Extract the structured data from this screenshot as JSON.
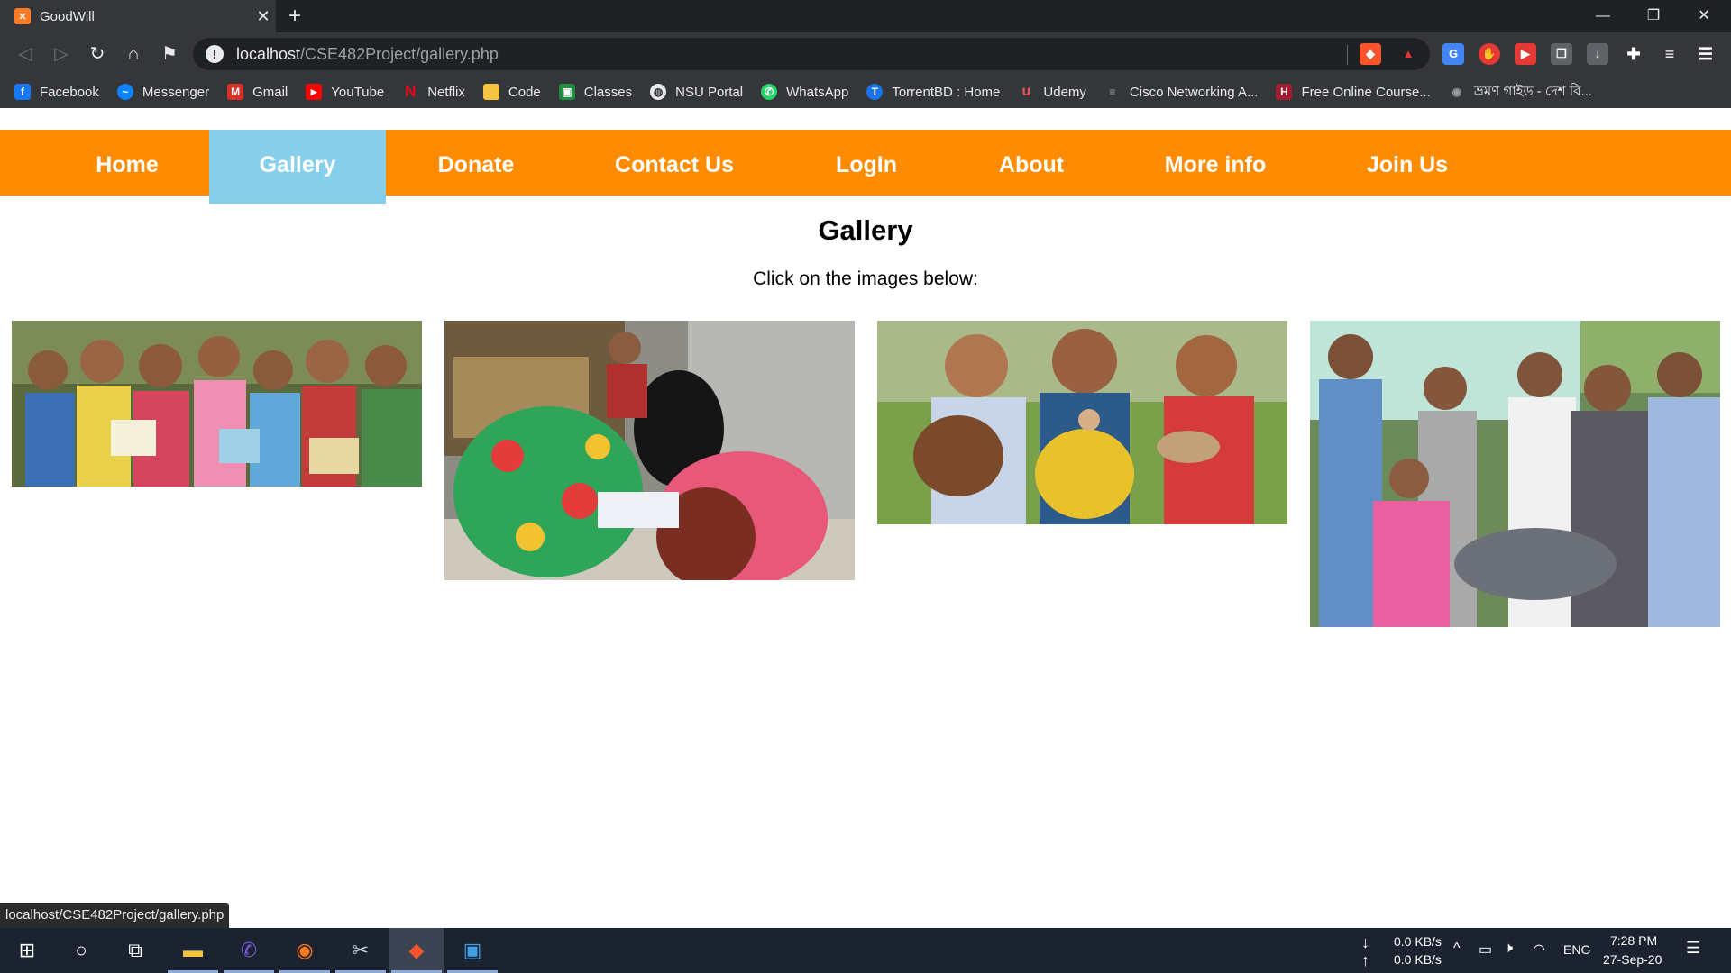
{
  "browser": {
    "tab_title": "GoodWill",
    "tab_favicon": "xampp-icon",
    "url_host": "localhost",
    "url_path": "/CSE482Project/gallery.php",
    "bookmarks": [
      {
        "label": "Facebook",
        "icon": "facebook-icon",
        "color": "#1877f2",
        "glyph": "f"
      },
      {
        "label": "Messenger",
        "icon": "messenger-icon",
        "color": "#0a84ff",
        "glyph": "~"
      },
      {
        "label": "Gmail",
        "icon": "gmail-icon",
        "color": "#d93025",
        "glyph": "M"
      },
      {
        "label": "YouTube",
        "icon": "youtube-icon",
        "color": "#ff0000",
        "glyph": "▶"
      },
      {
        "label": "Netflix",
        "icon": "netflix-icon",
        "color": "#e50914",
        "glyph": "N"
      },
      {
        "label": "Code",
        "icon": "folder-icon",
        "color": "#f6c343",
        "glyph": ""
      },
      {
        "label": "Classes",
        "icon": "google-classroom-icon",
        "color": "#1e8e3e",
        "glyph": "▣"
      },
      {
        "label": "NSU Portal",
        "icon": "globe-icon",
        "color": "#5f6368",
        "glyph": "◍"
      },
      {
        "label": "WhatsApp",
        "icon": "whatsapp-icon",
        "color": "#25d366",
        "glyph": "✆"
      },
      {
        "label": "TorrentBD : Home",
        "icon": "torrentbd-icon",
        "color": "#1a73e8",
        "glyph": "T"
      },
      {
        "label": "Udemy",
        "icon": "udemy-icon",
        "color": "#a435f0",
        "glyph": "U"
      },
      {
        "label": "Cisco Networking A...",
        "icon": "cisco-icon",
        "color": "#049fd9",
        "glyph": "≡"
      },
      {
        "label": "Free Online Course...",
        "icon": "harvard-icon",
        "color": "#a51c30",
        "glyph": "H"
      },
      {
        "label": "ভ্রমণ গাইড - দেশ বি...",
        "icon": "location-pin-icon",
        "color": "#5f6368",
        "glyph": "◉"
      }
    ]
  },
  "site": {
    "nav": [
      "Home",
      "Gallery",
      "Donate",
      "Contact Us",
      "LogIn",
      "About",
      "More info",
      "Join Us"
    ],
    "active_nav": "Gallery",
    "nav_color": "#ff8c00",
    "active_color": "#87ceeb",
    "heading": "Gallery",
    "subheading": "Click on the images below:",
    "photos": [
      "children-with-books-photo",
      "women-writing-photo",
      "children-with-goats-photo",
      "donation-ceremony-photo"
    ]
  },
  "status": {
    "hover_url": "localhost/CSE482Project/gallery.php"
  },
  "taskbar": {
    "net_down": "0.0 KB/s",
    "net_up": "0.0 KB/s",
    "lang": "ENG",
    "time": "7:28 PM",
    "date": "27-Sep-20"
  }
}
